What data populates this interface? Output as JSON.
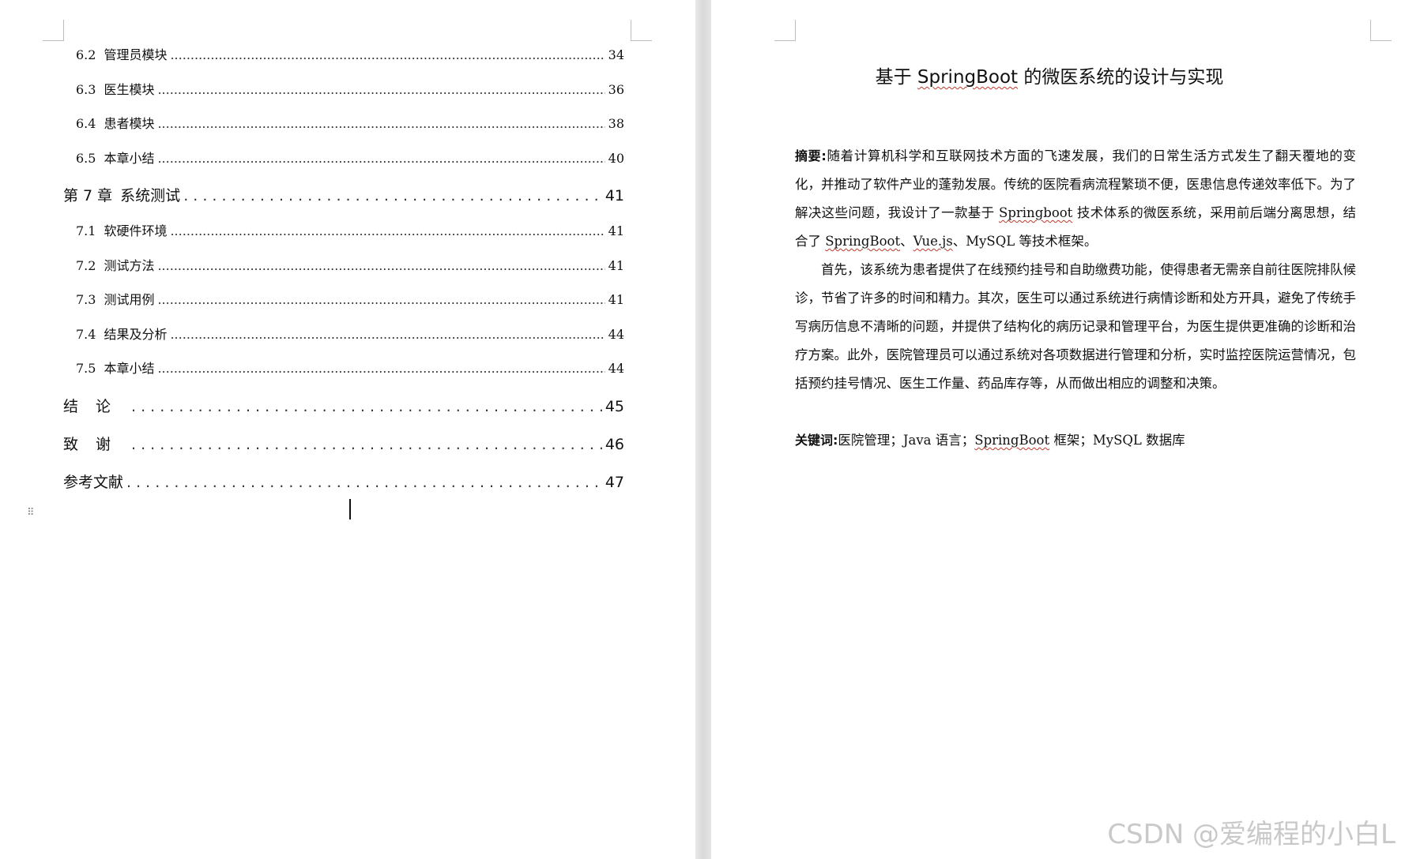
{
  "toc": {
    "entries": [
      {
        "level": "sub",
        "num": "6.2",
        "title": "管理员模块",
        "page": "34"
      },
      {
        "level": "sub",
        "num": "6.3",
        "title": "医生模块",
        "page": "36"
      },
      {
        "level": "sub",
        "num": "6.4",
        "title": "患者模块",
        "page": "38"
      },
      {
        "level": "sub",
        "num": "6.5",
        "title": "本章小结",
        "page": "40"
      },
      {
        "level": "chap",
        "num": "第 7 章",
        "title": "系统测试",
        "page": "41"
      },
      {
        "level": "sub",
        "num": "7.1",
        "title": "软硬件环境",
        "page": "41"
      },
      {
        "level": "sub",
        "num": "7.2",
        "title": "测试方法",
        "page": "41"
      },
      {
        "level": "sub",
        "num": "7.3",
        "title": "测试用例",
        "page": "41"
      },
      {
        "level": "sub",
        "num": "7.4",
        "title": "结果及分析",
        "page": "44"
      },
      {
        "level": "sub",
        "num": "7.5",
        "title": "本章小结",
        "page": "44"
      },
      {
        "level": "chap",
        "num": "",
        "title": "结论",
        "page": "45"
      },
      {
        "level": "chap",
        "num": "",
        "title": "致谢",
        "page": "46"
      },
      {
        "level": "chap",
        "num": "",
        "title": "参考文献",
        "page": "47"
      }
    ]
  },
  "document": {
    "title_pre": "基于 ",
    "title_en": "SpringBoot",
    "title_post": " 的微医系统的设计与实现",
    "abstract_label": "摘要:",
    "abstract_p1_a": "随着计算机科学和互联网技术方面的飞速发展，我们的日常生活方式发生了翻天覆地的变化，并推动了软件产业的蓬勃发展。传统的医院看病流程繁琐不便，医患信息传递效率低下。为了解决这些问题，我设计了一款基于 ",
    "abstract_p1_springboot": "Springboot",
    "abstract_p1_b": " 技术体系的微医系统，采用前后端分离思想，结合了 ",
    "abstract_p1_springboot2": "SpringBoot",
    "abstract_p1_sep1": "、",
    "abstract_p1_vue": "Vue.js",
    "abstract_p1_c": "、MySQL 等技术框架。",
    "abstract_p2": "首先，该系统为患者提供了在线预约挂号和自助缴费功能，使得患者无需亲自前往医院排队候诊，节省了许多的时间和精力。其次，医生可以通过系统进行病情诊断和处方开具，避免了传统手写病历信息不清晰的问题，并提供了结构化的病历记录和管理平台，为医生提供更准确的诊断和治疗方案。此外，医院管理员可以通过系统对各项数据进行管理和分析，实时监控医院运营情况，包括预约挂号情况、医生工作量、药品库存等，从而做出相应的调整和决策。",
    "keywords_label": "关键词:",
    "keywords_a": "医院管理；Java 语言；",
    "keywords_springboot": "SpringBoot",
    "keywords_b": " 框架；MySQL 数据库"
  },
  "watermark": "CSDN @爱编程的小白L"
}
